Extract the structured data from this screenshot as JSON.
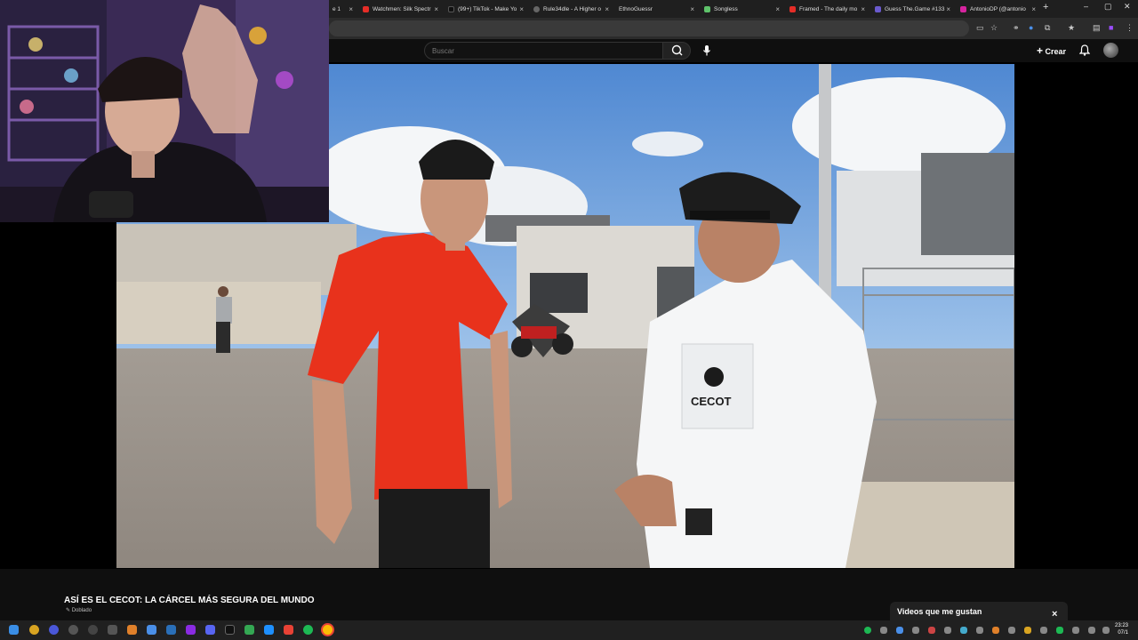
{
  "browser": {
    "tabs": [
      {
        "label": "e 1",
        "color": "#888888"
      },
      {
        "label": "Watchmen: Silk Spectr",
        "color": "#e52d27"
      },
      {
        "label": "(99+) TikTok - Make Yo",
        "color": "#111111"
      },
      {
        "label": "Rule34dle - A Higher o",
        "color": "#666666"
      },
      {
        "label": "EthnoGuessr",
        "color": "#888888"
      },
      {
        "label": "Songless",
        "color": "#5ec26a"
      },
      {
        "label": "Framed - The daily mo",
        "color": "#e52d27"
      },
      {
        "label": "Guess The.Game #133",
        "color": "#6a5acd"
      },
      {
        "label": "AntonioDP (@antonio",
        "color": "#d6249f"
      }
    ],
    "close_glyph": "×",
    "newtab_glyph": "+",
    "window_controls": [
      "–",
      "▢",
      "✕"
    ]
  },
  "youtube": {
    "search_placeholder": "Buscar",
    "create_label": "Crear",
    "video_title": "ASÍ ES EL CECOT: LA CÁRCEL MÁS SEGURA DEL MUNDO",
    "dub_label": "Doblado",
    "liked_panel_title": "Videos que me gustan",
    "liked_close": "×",
    "badge_text": "CECOT"
  },
  "taskbar": {
    "time": "23:23",
    "date": "07/1"
  },
  "colors": {
    "accent": "#ff0000",
    "shirt_red": "#e8321c",
    "sky": "#5d93d8"
  }
}
